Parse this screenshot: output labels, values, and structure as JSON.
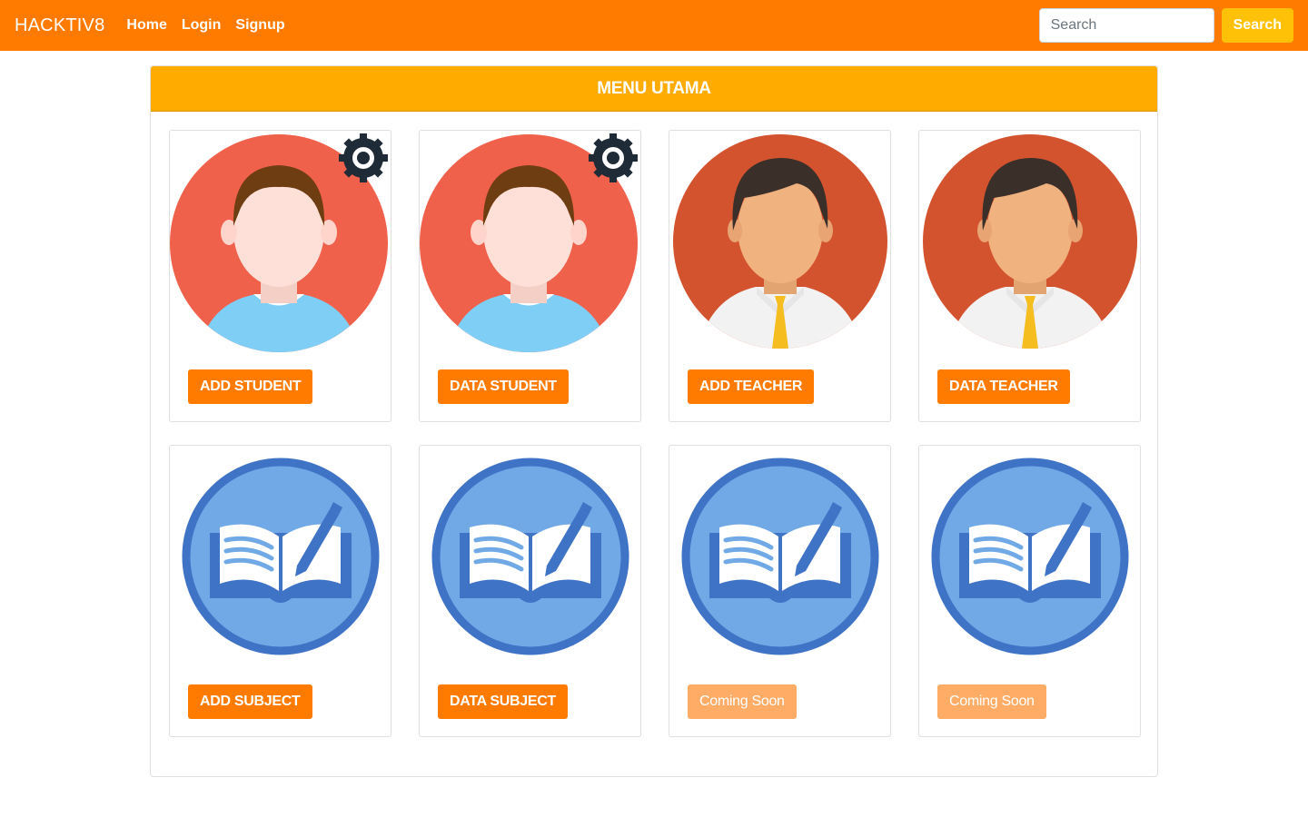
{
  "navbar": {
    "brand": "HACKTIV8",
    "links": [
      "Home",
      "Login",
      "Signup"
    ],
    "search_placeholder": "Search",
    "search_button": "Search"
  },
  "main": {
    "header": "MENU UTAMA",
    "tiles": [
      {
        "label": "ADD STUDENT",
        "icon": "student-admin-icon",
        "enabled": true
      },
      {
        "label": "DATA STUDENT",
        "icon": "student-admin-icon",
        "enabled": true
      },
      {
        "label": "ADD TEACHER",
        "icon": "teacher-icon",
        "enabled": true
      },
      {
        "label": "DATA TEACHER",
        "icon": "teacher-icon",
        "enabled": true
      },
      {
        "label": "ADD SUBJECT",
        "icon": "book-pencil-icon",
        "enabled": true
      },
      {
        "label": "DATA SUBJECT",
        "icon": "book-pencil-icon",
        "enabled": true
      },
      {
        "label": "Coming Soon",
        "icon": "book-pencil-icon",
        "enabled": false
      },
      {
        "label": "Coming Soon",
        "icon": "book-pencil-icon",
        "enabled": false
      }
    ]
  },
  "colors": {
    "navbar": "#ff7b00",
    "header": "#ffab00",
    "button": "#ff7b00",
    "button_disabled": "#ffac66",
    "search_button": "#ffc107"
  }
}
